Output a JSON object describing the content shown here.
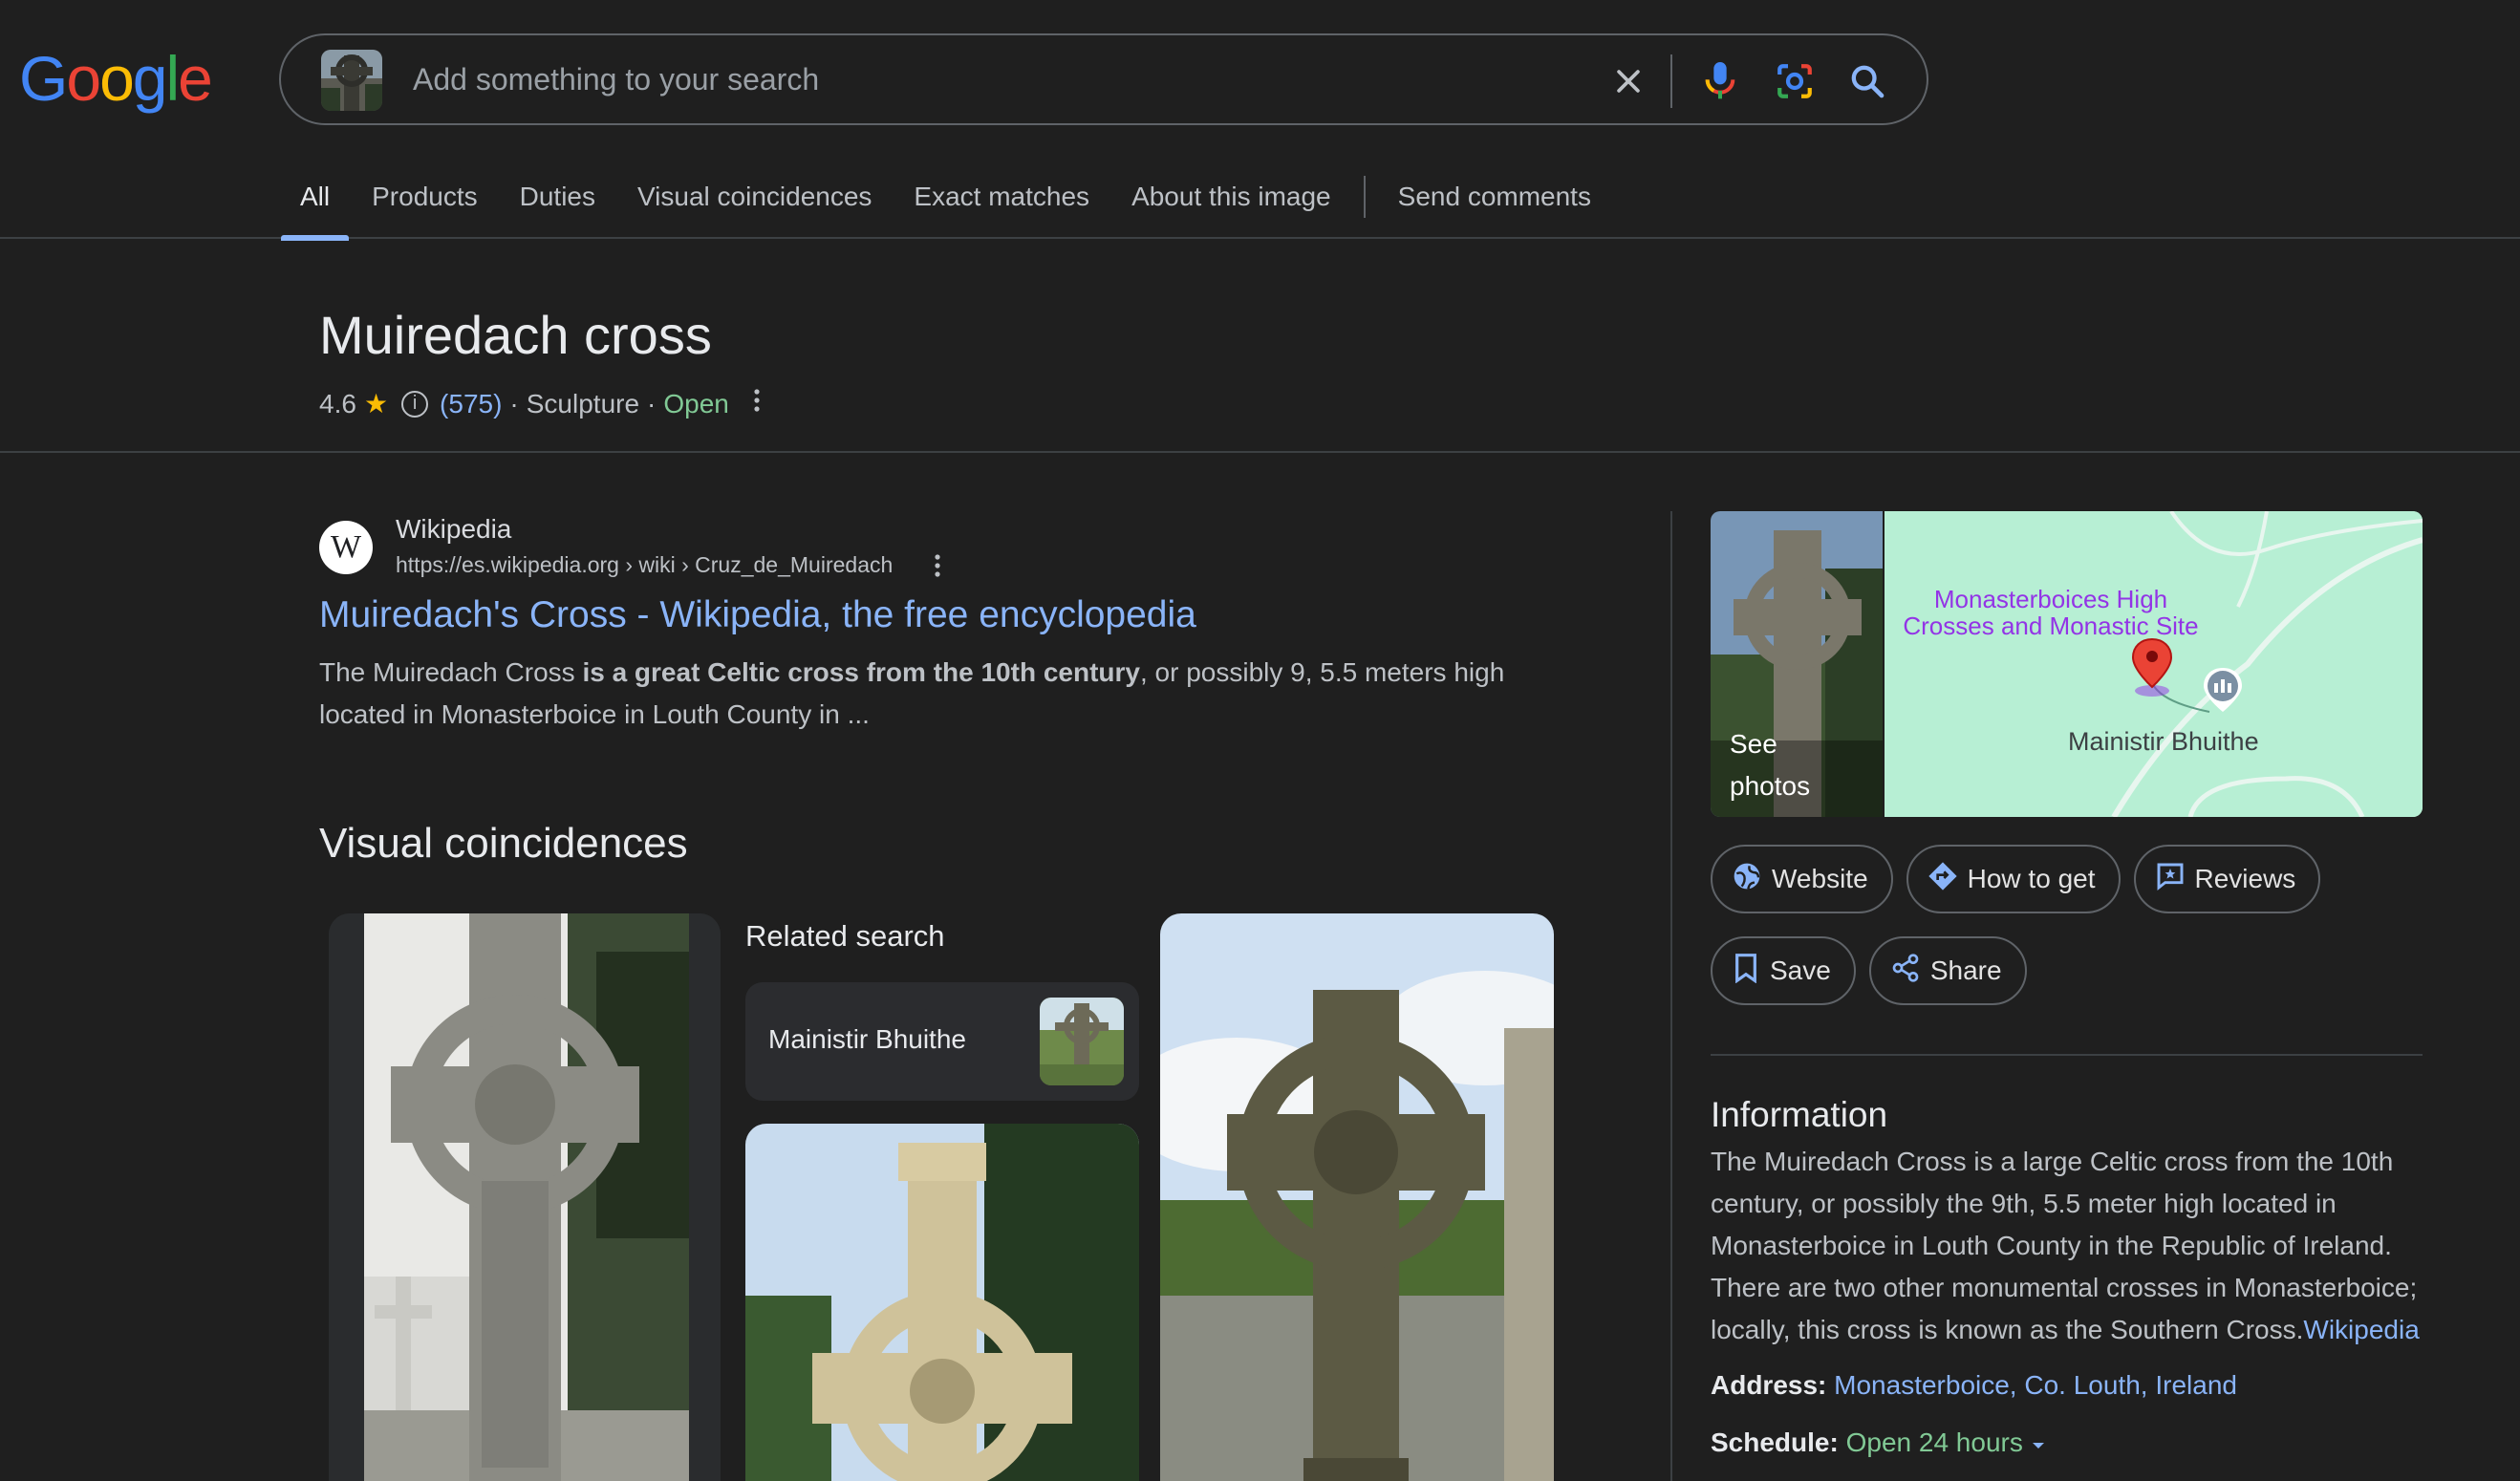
{
  "logo": {
    "letters": [
      "G",
      "o",
      "o",
      "g",
      "l",
      "e"
    ]
  },
  "search": {
    "placeholder": "Add something to your search",
    "value": ""
  },
  "icons": {
    "clear": "close-icon",
    "voice": "microphone-icon",
    "lens": "lens-camera-icon",
    "search": "search-icon"
  },
  "tabs": [
    {
      "label": "All",
      "active": true
    },
    {
      "label": "Products"
    },
    {
      "label": "Duties"
    },
    {
      "label": "Visual coincidences"
    },
    {
      "label": "Exact matches"
    },
    {
      "label": "About this image"
    },
    {
      "label": "Send comments"
    }
  ],
  "entity": {
    "title": "Muiredach cross",
    "rating": "4.6",
    "reviews": "(575)",
    "category": "Sculpture",
    "status": "Open",
    "sep": "·"
  },
  "result": {
    "favicon_letter": "W",
    "site_name": "Wikipedia",
    "url": "https://es.wikipedia.org › wiki › Cruz_de_Muiredach",
    "title": "Muiredach's Cross - Wikipedia, the free encyclopedia",
    "snippet_pre": "The Muiredach Cross ",
    "snippet_bold": "is a great Celtic cross from the 10th century",
    "snippet_post": ", or possibly 9, 5.5 meters high located in Monasterboice in Louth County in ..."
  },
  "visual": {
    "heading": "Visual coincidences",
    "related_heading": "Related search",
    "related_chip": "Mainistir Bhuithe"
  },
  "panel": {
    "see_photos": "See photos",
    "map_label": "Monasterboices High Crosses and Monastic Site",
    "map_label2": "Mainistir Bhuithe",
    "actions": [
      "Website",
      "How to get",
      "Reviews",
      "Save",
      "Share"
    ],
    "info_heading": "Information",
    "info_text": "The Muiredach Cross is a large Celtic cross from the 10th century, or possibly the 9th, 5.5 meter high located in Monasterboice in Louth County in the Republic of Ireland. There are two other monumental crosses in Monasterboice; locally, this cross is known as the Southern Cross.",
    "info_link": "Wikipedia",
    "address_label": "Address:",
    "address_value": "Monasterboice, Co. Louth, Ireland",
    "schedule_label": "Schedule:",
    "schedule_value": "Open 24 hours"
  },
  "colors": {
    "background": "#1f1f1f",
    "link": "#8ab4f8",
    "open_green": "#81c995",
    "star": "#fbbc04",
    "map_purple": "#9334e6"
  }
}
